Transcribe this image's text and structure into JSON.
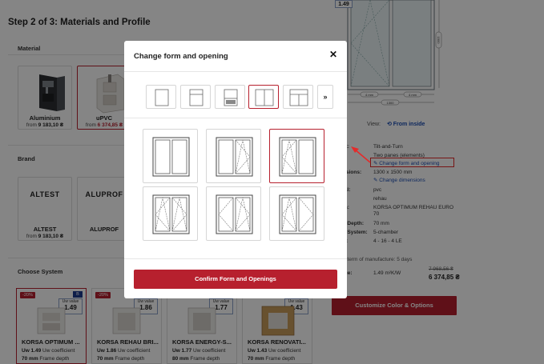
{
  "step_title": "Step 2 of 3: Materials and Profile",
  "sections": {
    "material": "Material",
    "brand": "Brand",
    "system": "Choose System"
  },
  "materials": [
    {
      "name": "Aluminium",
      "price_prefix": "from",
      "price": "9 183,10 ₴",
      "selected": false
    },
    {
      "name": "uPVC",
      "price_prefix": "from",
      "price": "6 374,85 ₴",
      "selected": true
    }
  ],
  "brands": [
    {
      "logo": "ALTEST",
      "name": "ALTEST",
      "price_prefix": "from",
      "price": "9 183,10 ₴"
    },
    {
      "logo": "ALUPROF",
      "name": "ALUPROF",
      "price_prefix": "",
      "price": ""
    }
  ],
  "systems": [
    {
      "name": "KORSA OPTIMUM ...",
      "discount": "-20%",
      "flag": "B",
      "uw_label": "Uw value",
      "uw": "1.49",
      "line1_val": "Uw 1.49",
      "line1_txt": "Uw coefficient",
      "line2_val": "70 mm",
      "line2_txt": "Frame depth",
      "selected": true
    },
    {
      "name": "KORSA REHAU BRI...",
      "discount": "-20%",
      "flag": "",
      "uw_label": "Uw value",
      "uw": "1.86",
      "line1_val": "Uw 1.86",
      "line1_txt": "Uw coefficient",
      "line2_val": "70 mm",
      "line2_txt": "Frame depth",
      "selected": false
    },
    {
      "name": "KORSA ENERGY-S...",
      "discount": "",
      "flag": "",
      "uw_label": "Uw value",
      "uw": "1.77",
      "line1_val": "Uw 1.77",
      "line1_txt": "Uw coefficient",
      "line2_val": "80 mm",
      "line2_txt": "Frame depth",
      "selected": false
    },
    {
      "name": "KORSA RENOVATI...",
      "discount": "",
      "flag": "",
      "uw_label": "Uw value",
      "uw": "1.43",
      "line1_val": "Uw 1.43",
      "line1_txt": "Uw coefficient",
      "line2_val": "70 mm",
      "line2_txt": "Frame depth",
      "selected": false
    }
  ],
  "preview": {
    "uw": "1.49",
    "dim_left": "4 mm",
    "dim_right": "4 mm",
    "dim_total": "1300",
    "dim_height": "1500"
  },
  "view": {
    "label": "View:",
    "link": "From inside"
  },
  "specs": [
    {
      "key": "ct:",
      "value": "Tilt-and-Turn"
    },
    {
      "key": "",
      "value": "Two panes (elements)"
    },
    {
      "key": "nsions:",
      "value": "1300 x 1500 mm"
    },
    {
      "key": "ial:",
      "value": "pvc"
    },
    {
      "key": "",
      "value": "rehau"
    },
    {
      "key": "m:",
      "value": "KORSA OPTIMUM REHAU EURO"
    },
    {
      "key": "",
      "value": "70"
    },
    {
      "key": "e Depth:",
      "value": "70 mm"
    },
    {
      "key": "e System:",
      "value": "5-chamber"
    },
    {
      "key": "g:",
      "value": "4 - 16 - 4 LE"
    }
  ],
  "spec_links": {
    "change_form": "Change form and opening",
    "change_dims": "Change dimensions"
  },
  "term": "e term of manufacture: 5 days",
  "uvalue": {
    "key": "lue:",
    "value": "1.49 m²K/W"
  },
  "price_old": "7 968,56 ₴",
  "price_new": "6 374,85 ₴",
  "customize_button": "Customize Color & Options",
  "modal": {
    "title": "Change form and opening",
    "nav_next": "»",
    "confirm": "Confirm Form and Openings"
  },
  "colors": {
    "accent": "#b7202e",
    "link": "#1b4db3",
    "annotation": "#e52a2a"
  },
  "icons": [
    "close-icon",
    "pencil-icon",
    "rotate-icon",
    "chevron-double-right-icon"
  ]
}
